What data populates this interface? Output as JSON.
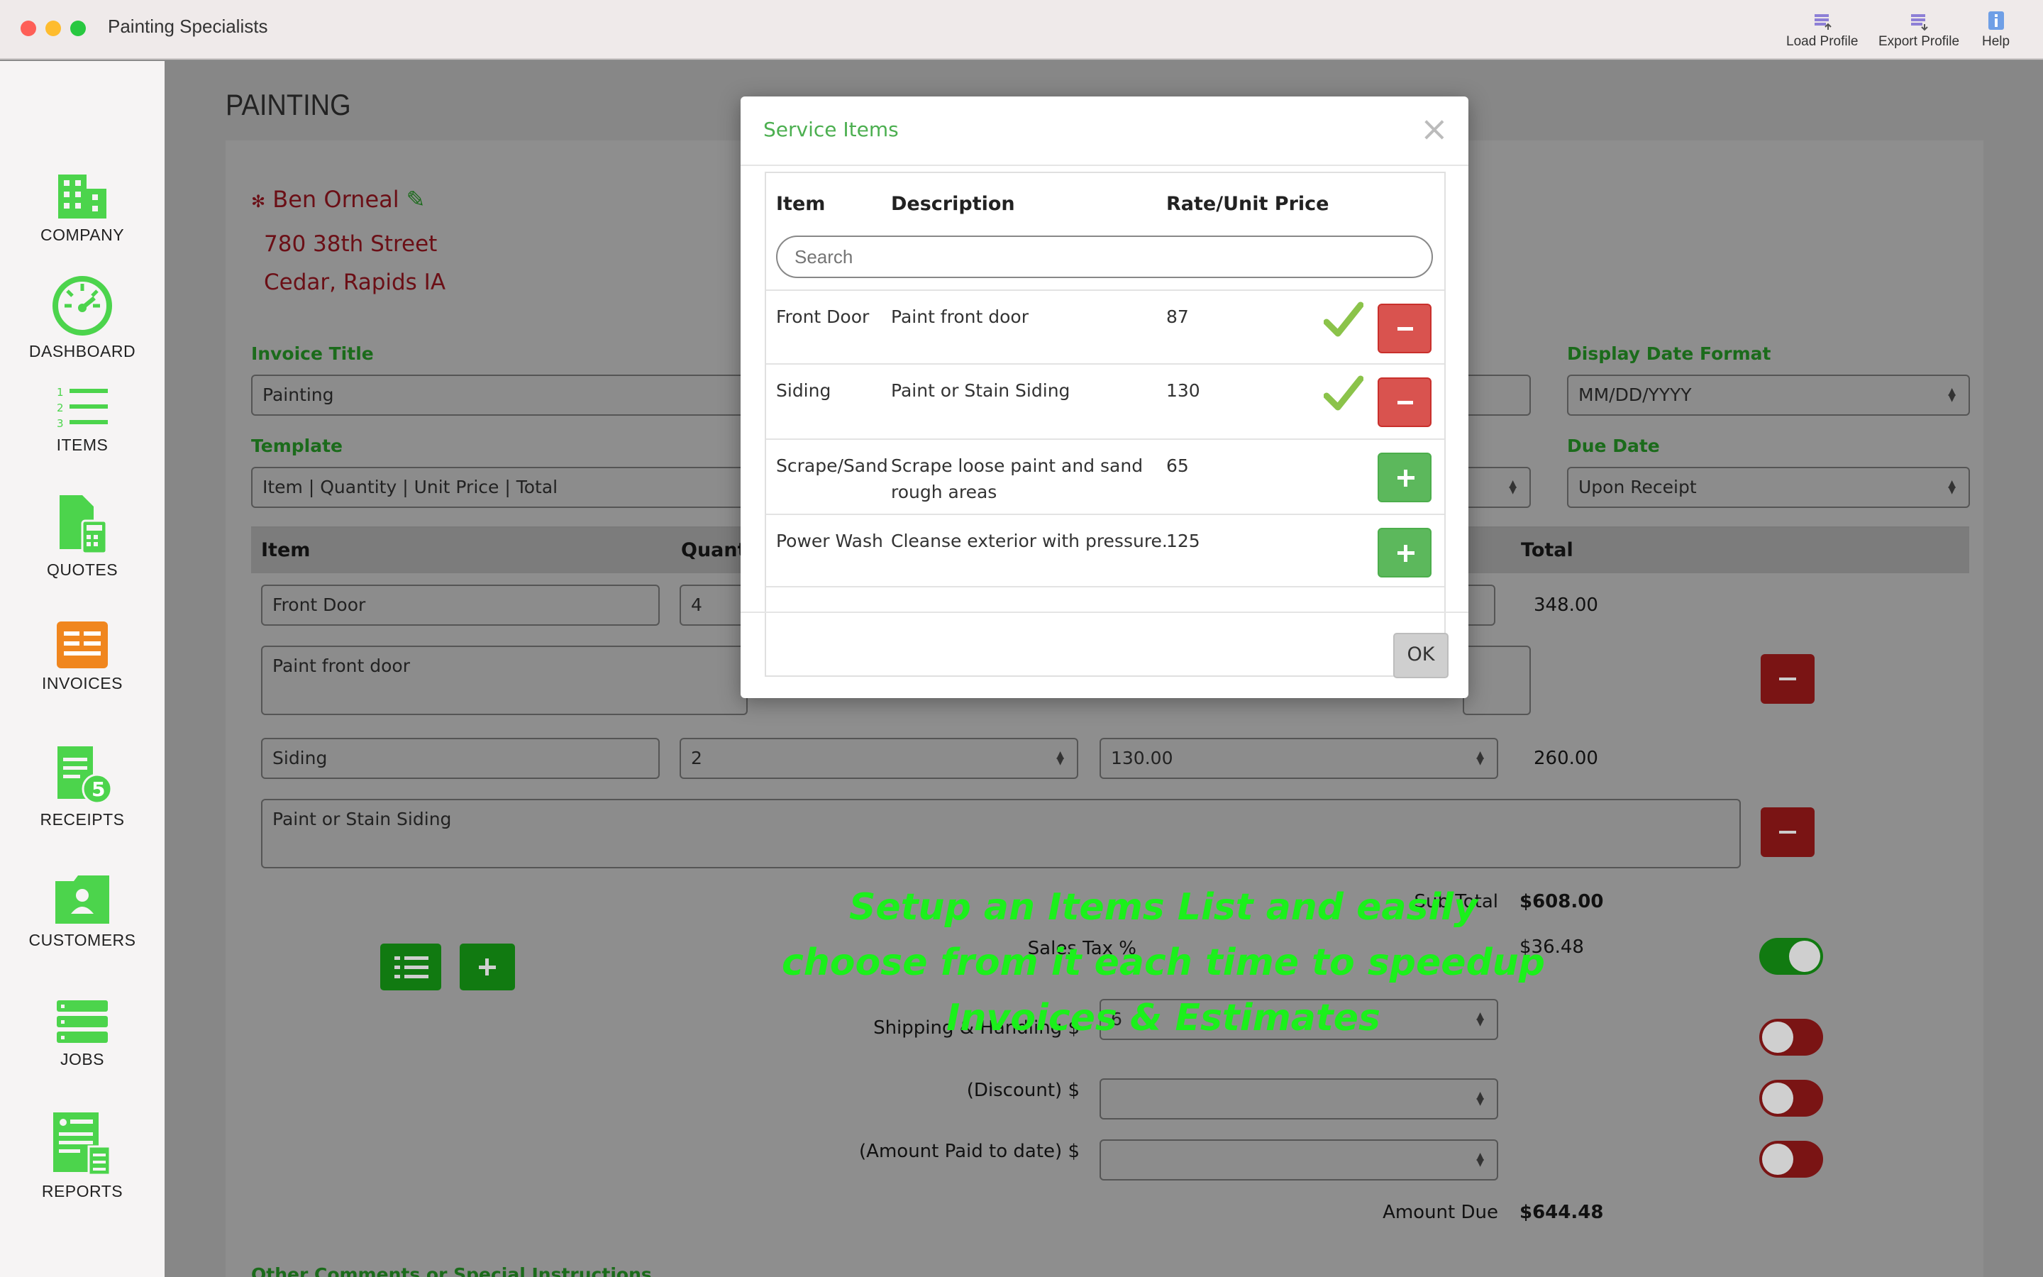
{
  "window": {
    "title": "Painting Specialists",
    "toolbar": {
      "load_profile": "Load Profile",
      "export_profile": "Export Profile",
      "help": "Help"
    }
  },
  "sidebar": {
    "items": [
      {
        "label": "COMPANY",
        "icon": "building-icon"
      },
      {
        "label": "DASHBOARD",
        "icon": "gauge-icon"
      },
      {
        "label": "ITEMS",
        "icon": "numbered-list-icon"
      },
      {
        "label": "QUOTES",
        "icon": "calculator-doc-icon"
      },
      {
        "label": "INVOICES",
        "icon": "invoice-icon"
      },
      {
        "label": "RECEIPTS",
        "icon": "receipt-icon",
        "badge": "5"
      },
      {
        "label": "CUSTOMERS",
        "icon": "customer-folder-icon"
      },
      {
        "label": "JOBS",
        "icon": "stack-icon"
      },
      {
        "label": "REPORTS",
        "icon": "report-icon"
      }
    ],
    "accent": "#4cd44c"
  },
  "main": {
    "page_title": "PAINTING",
    "customer": {
      "name": "Ben Orneal",
      "address_line1": "780 38th Street",
      "address_line2": "Cedar, Rapids IA"
    },
    "invoice_title_label": "Invoice Title",
    "invoice_title_value": "Painting",
    "template_label": "Template",
    "template_value": "Item | Quantity | Unit Price | Total",
    "display_date_label": "Display Date Format",
    "display_date_value": "MM/DD/YYYY",
    "due_date_label": "Due Date",
    "due_date_value": "Upon Receipt",
    "grid_headers": {
      "item": "Item",
      "quantity": "Quantit",
      "total": "Total"
    },
    "lines": [
      {
        "item": "Front Door",
        "qty": "4",
        "price": "",
        "total": "348.00",
        "description": "Paint front door"
      },
      {
        "item": "Siding",
        "qty": "2",
        "price": "130.00",
        "total": "260.00",
        "description": "Paint or Stain Siding"
      }
    ],
    "totals": {
      "subtotal_label": "Sub Total",
      "subtotal_value": "$608.00",
      "sales_tax_label": "Sales Tax %",
      "sales_tax_input": "6",
      "sales_tax_value": "$36.48",
      "shipping_label": "Shipping & Handling $",
      "discount_label": "(Discount) $",
      "amount_paid_label": "(Amount Paid to date) $",
      "amount_due_label": "Amount Due",
      "amount_due_value": "$644.48"
    },
    "comments_label": "Other Comments or Special Instructions"
  },
  "promo": {
    "line1": "Setup an Items  List and easily",
    "line2": "choose from it each time to speedup",
    "line3": "Invoices & Estimates",
    "color": "#1bf01b"
  },
  "modal": {
    "title": "Service Items",
    "close": "×",
    "headers": {
      "item": "Item",
      "description": "Description",
      "rate": "Rate/Unit Price"
    },
    "search_placeholder": "Search",
    "rows": [
      {
        "item": "Front Door",
        "description": "Paint front door",
        "rate": "87",
        "selected": true
      },
      {
        "item": "Siding",
        "description": "Paint or Stain Siding",
        "rate": "130",
        "selected": true
      },
      {
        "item": "Scrape/Sand",
        "description": "Scrape loose paint and sand rough areas",
        "rate": "65",
        "selected": false
      },
      {
        "item": "Power Wash",
        "description": "Cleanse exterior with pressure.",
        "rate": "125",
        "selected": false
      }
    ],
    "ok_label": "OK",
    "title_color": "#4caf50"
  }
}
